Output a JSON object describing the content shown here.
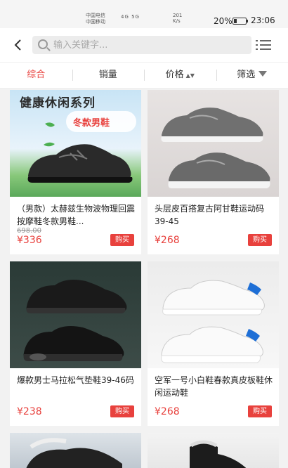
{
  "status_bar": {
    "carrier1": "中国电信",
    "carrier2": "中国移动",
    "network": "4G  5G",
    "speed_value": "201",
    "speed_unit": "K/s",
    "battery": "20%",
    "time": "23:06"
  },
  "search": {
    "placeholder": "输入关键字..."
  },
  "tabs": [
    {
      "label": "综合",
      "active": true
    },
    {
      "label": "销量",
      "active": false
    },
    {
      "label": "价格",
      "active": false
    },
    {
      "label": "筛选",
      "active": false
    }
  ],
  "products": [
    {
      "title": "（男款）太赫兹生物波物理回震按摩鞋冬款男鞋...",
      "original_price": "698.00",
      "price": "¥336",
      "buy_label": "购买",
      "image_icon": "black-sneaker-icon",
      "promo_title": "健康休闲系列",
      "promo_sub": "冬款男鞋"
    },
    {
      "title": "头层皮百搭复古阿甘鞋运动码39-45",
      "price": "¥268",
      "buy_label": "购买",
      "image_icon": "gray-sneaker-icon"
    },
    {
      "title": "爆款男士马拉松气垫鞋39-46码",
      "price": "¥238",
      "buy_label": "购买",
      "image_icon": "black-air-sneaker-icon"
    },
    {
      "title": "空军一号小白鞋春款真皮板鞋休闲运动鞋",
      "price": "¥268",
      "buy_label": "购买",
      "image_icon": "white-sneaker-icon"
    }
  ],
  "colors": {
    "accent": "#e8413d",
    "background": "#f2f2f2"
  }
}
